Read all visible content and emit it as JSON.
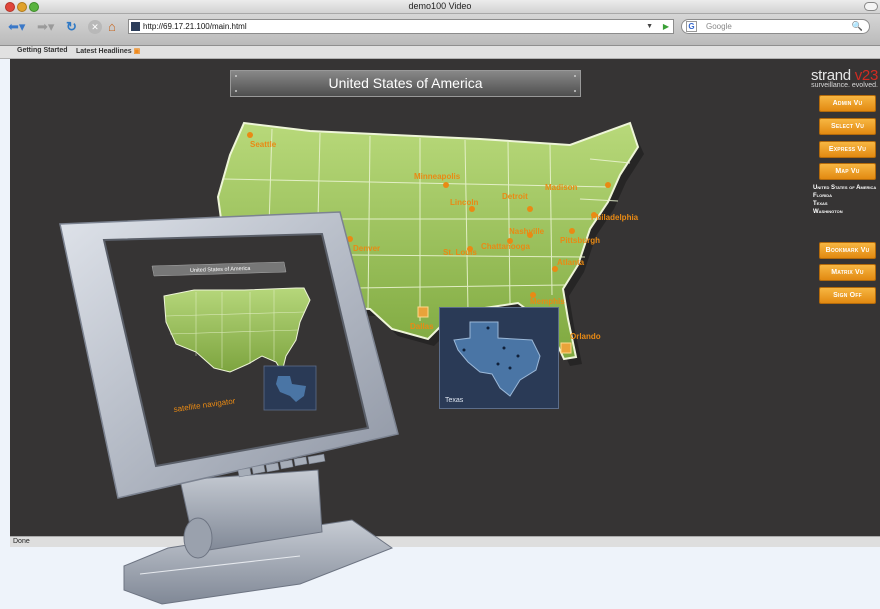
{
  "window": {
    "title": "demo100 Video"
  },
  "toolbar": {
    "url": "http://69.17.21.100/main.html",
    "search_placeholder": "Google",
    "search_engine_icon": "G"
  },
  "bookmarks": {
    "items": [
      "Getting Started",
      "Latest Headlines"
    ]
  },
  "status": {
    "text": "Done"
  },
  "map": {
    "title": "United States of America",
    "cities": [
      "Seattle",
      "Minneapolis",
      "Detroit",
      "Nashville",
      "Lincoln",
      "St. Louis",
      "Denver",
      "Chattanooga",
      "Atlanta",
      "Memphis",
      "Madison",
      "Philadelphia",
      "Pittsburgh",
      "Dallas",
      "Orlando"
    ],
    "inset_label": "Texas",
    "colors": {
      "land": "#9cc55a",
      "land_dark": "#6d9933",
      "border": "#eef5d8",
      "city": "#e98a14",
      "background": "#363434"
    }
  },
  "monitor_screen": {
    "title": "United States of America",
    "brand_text": "satellite navigator"
  },
  "logo": {
    "name": "strand",
    "version": "v23",
    "tagline": "surveillance. evolved."
  },
  "nav": {
    "admin": "Admin Vu",
    "select": "Select Vu",
    "express": "Express Vu",
    "map": "Map Vu",
    "bookmark": "Bookmark Vu",
    "matrix": "Matrix Vu",
    "signoff": "Sign Off"
  },
  "map_links": [
    "United States of America",
    "Florida",
    "Texas",
    "Washington"
  ]
}
